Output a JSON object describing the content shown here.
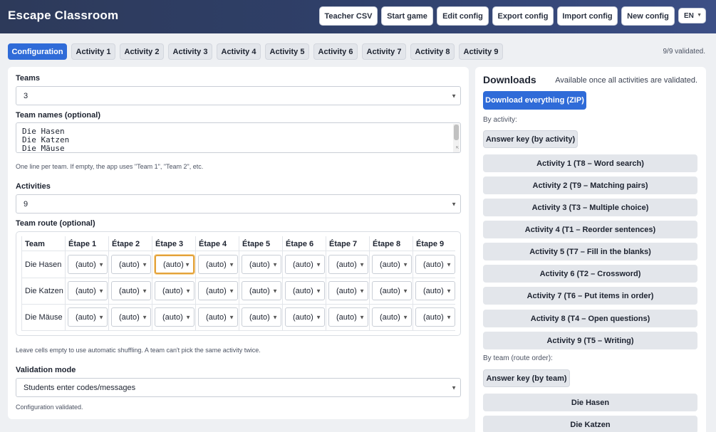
{
  "app": {
    "title": "Escape Classroom"
  },
  "toolbar": {
    "teacher_csv": "Teacher CSV",
    "start_game": "Start game",
    "edit_config": "Edit config",
    "export_config": "Export config",
    "import_config": "Import config",
    "new_config": "New config",
    "language": "EN"
  },
  "tabs": [
    "Configuration",
    "Activity 1",
    "Activity 2",
    "Activity 3",
    "Activity 4",
    "Activity 5",
    "Activity 6",
    "Activity 7",
    "Activity 8",
    "Activity 9"
  ],
  "active_tab": "Configuration",
  "validated_count": "9/9 validated.",
  "config": {
    "teams_label": "Teams",
    "teams_value": "3",
    "team_names_label": "Team names (optional)",
    "team_names": [
      "Die Hasen",
      "Die Katzen",
      "Die Mäuse"
    ],
    "team_names_hint": "One line per team. If empty, the app uses \"Team 1\", \"Team 2\", etc.",
    "activities_label": "Activities",
    "activities_value": "9",
    "route_label": "Team route (optional)",
    "route_table": {
      "headers": [
        "Team",
        "Étape 1",
        "Étape 2",
        "Étape 3",
        "Étape 4",
        "Étape 5",
        "Étape 6",
        "Étape 7",
        "Étape 8",
        "Étape 9"
      ],
      "rows": [
        {
          "team": "Die Hasen",
          "cells": [
            "(auto)",
            "(auto)",
            "(auto)",
            "(auto)",
            "(auto)",
            "(auto)",
            "(auto)",
            "(auto)",
            "(auto)"
          ]
        },
        {
          "team": "Die Katzen",
          "cells": [
            "(auto)",
            "(auto)",
            "(auto)",
            "(auto)",
            "(auto)",
            "(auto)",
            "(auto)",
            "(auto)",
            "(auto)"
          ]
        },
        {
          "team": "Die Mäuse",
          "cells": [
            "(auto)",
            "(auto)",
            "(auto)",
            "(auto)",
            "(auto)",
            "(auto)",
            "(auto)",
            "(auto)",
            "(auto)"
          ]
        }
      ]
    },
    "route_hint": "Leave cells empty to use automatic shuffling. A team can't pick the same activity twice.",
    "validation_label": "Validation mode",
    "validation_value": "Students enter codes/messages",
    "status": "Configuration validated."
  },
  "downloads": {
    "title": "Downloads",
    "note": "Available once all activities are validated.",
    "download_all": "Download everything (ZIP)",
    "by_activity_label": "By activity:",
    "answer_key_activity": "Answer key (by activity)",
    "activities": [
      "Activity 1 (T8 – Word search)",
      "Activity 2 (T9 – Matching pairs)",
      "Activity 3 (T3 – Multiple choice)",
      "Activity 4 (T1 – Reorder sentences)",
      "Activity 5 (T7 – Fill in the blanks)",
      "Activity 6 (T2 – Crossword)",
      "Activity 7 (T6 – Put items in order)",
      "Activity 8 (T4 – Open questions)",
      "Activity 9 (T5 – Writing)"
    ],
    "by_team_label": "By team (route order):",
    "answer_key_team": "Answer key (by team)",
    "teams": [
      "Die Hasen",
      "Die Katzen"
    ]
  },
  "colors": {
    "topbar": "#2f3f68",
    "accent": "#2f6bd8",
    "focus": "#e3a23a"
  },
  "icons": {
    "select": "chevron-down-icon",
    "resize": "resize-handle-icon"
  }
}
